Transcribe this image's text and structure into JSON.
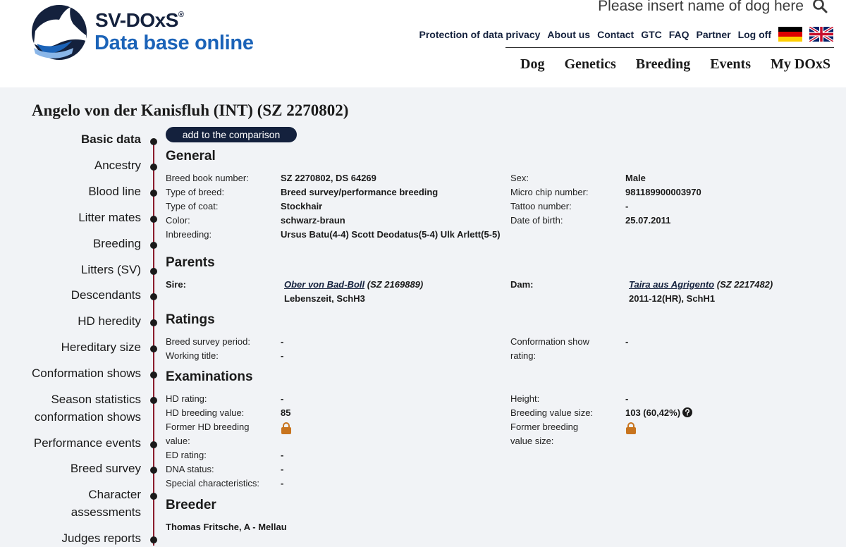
{
  "header": {
    "brand": "SV-DOxS",
    "brand_mark": "®",
    "subtitle": "Data base online",
    "search_placeholder": "Please insert name of dog here",
    "top_links": [
      "Protection of data privacy",
      "About us",
      "Contact",
      "GTC",
      "FAQ",
      "Partner",
      "Log off"
    ],
    "main_nav": [
      "Dog",
      "Genetics",
      "Breeding",
      "Events",
      "My DOxS"
    ]
  },
  "page": {
    "title": "Angelo von der Kanisfluh (INT) (SZ 2270802)",
    "compare_button": "add to the comparison"
  },
  "sidebar": {
    "items": [
      "Basic data",
      "Ancestry",
      "Blood line",
      "Litter mates",
      "Breeding",
      "Litters (SV)",
      "Descendants",
      "HD heredity",
      "Hereditary size",
      "Conformation shows",
      "Season statistics conformation shows",
      "Performance events",
      "Breed survey",
      "Character assessments",
      "Judges reports"
    ],
    "item_lines": {
      "season_1": "Season statistics",
      "season_2": "conformation shows",
      "character_1": "Character",
      "character_2": "assessments"
    }
  },
  "general": {
    "heading": "General",
    "left": [
      {
        "label": "Breed book number:",
        "value": "SZ 2270802, DS 64269"
      },
      {
        "label": "Type of breed:",
        "value": "Breed survey/performance breeding"
      },
      {
        "label": "Type of coat:",
        "value": "Stockhair"
      },
      {
        "label": "Color:",
        "value": "schwarz-braun"
      },
      {
        "label": "Inbreeding:",
        "value": "Ursus Batu(4-4) Scott Deodatus(5-4) Ulk Arlett(5-5)"
      }
    ],
    "right": [
      {
        "label": "Sex:",
        "value": "Male"
      },
      {
        "label": "Micro chip number:",
        "value": "981189900003970"
      },
      {
        "label": "Tattoo number:",
        "value": "-"
      },
      {
        "label": "Date of birth:",
        "value": "25.07.2011"
      }
    ]
  },
  "parents": {
    "heading": "Parents",
    "sire_label": "Sire:",
    "sire_name": "Ober von Bad-Boll",
    "sire_reg": "(SZ 2169889)",
    "sire_info": "Lebenszeit, SchH3",
    "dam_label": "Dam:",
    "dam_name": "Taira aus Agrigento",
    "dam_reg": "(SZ 2217482)",
    "dam_info": "2011-12(HR), SchH1"
  },
  "ratings": {
    "heading": "Ratings",
    "breed_survey_label": "Breed survey period:",
    "breed_survey_value": "-",
    "working_title_label": "Working title:",
    "working_title_value": "-",
    "conformation_label": "Conformation show rating:",
    "conformation_value": "-"
  },
  "examinations": {
    "heading": "Examinations",
    "hd_rating_label": "HD rating:",
    "hd_rating_value": "-",
    "hd_breeding_label": "HD breeding value:",
    "hd_breeding_value": "85",
    "former_hd_label": "Former HD breeding value:",
    "ed_rating_label": "ED rating:",
    "ed_rating_value": "-",
    "dna_label": "DNA status:",
    "dna_value": "-",
    "special_label": "Special characteristics:",
    "special_value": "-",
    "height_label": "Height:",
    "height_value": "-",
    "bv_size_label": "Breeding value size:",
    "bv_size_value": "103 (60,42%)",
    "former_bv_label": "Former breeding value size:"
  },
  "breeder": {
    "heading": "Breeder",
    "name": "Thomas Fritsche, A - Mellau"
  },
  "colors": {
    "navy": "#14213d",
    "brand_blue": "#1b63b8",
    "timeline": "#8a1a2c",
    "lock": "#c8741e"
  },
  "icons": [
    "search-icon",
    "germany-flag-icon",
    "uk-flag-icon",
    "lock-icon",
    "help-icon"
  ]
}
